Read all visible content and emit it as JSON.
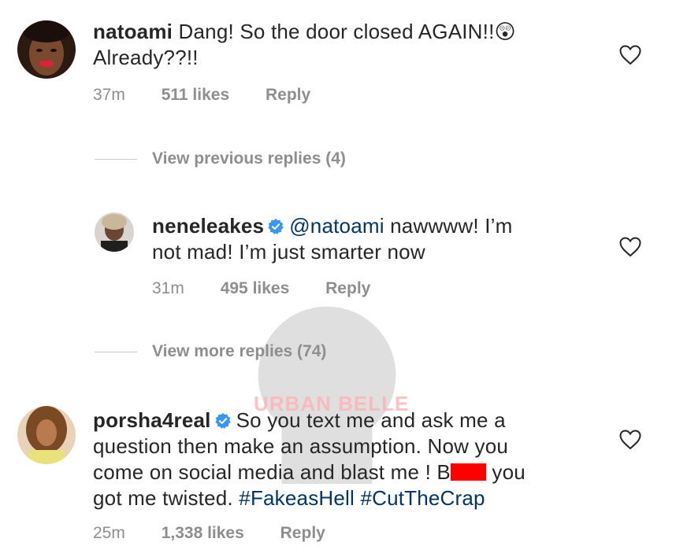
{
  "comments": [
    {
      "username": "natoami",
      "text_line1": "Dang!  So the door closed AGAIN!!",
      "text_line2": "Already??!!",
      "emoji": "😲",
      "time": "37m",
      "likes": "511 likes",
      "reply": "Reply"
    }
  ],
  "view_previous": "View previous replies (4)",
  "reply1": {
    "username": "neneleakes",
    "mention": "@natoami",
    "text_line1": " nawwww! I’m",
    "text_line2": "not mad! I’m just smarter now",
    "time": "31m",
    "likes": "495 likes",
    "reply": "Reply"
  },
  "view_more": "View more replies (74)",
  "comment2": {
    "username": "porsha4real",
    "text_line1": "So you text me and ask me a",
    "text_line2": "question then make an assumption. Now you",
    "text_line3a": "come on social media and blast me ! B",
    "text_line3b": " you",
    "text_line4a": "got me twisted. ",
    "hashtag1": "#FakeasHell",
    "hashtag2": "#CutTheCrap",
    "time": "25m",
    "likes": "1,338 likes",
    "reply": "Reply"
  },
  "watermark": "URBAN BELLE",
  "colors": {
    "text": "#262626",
    "meta": "#8e8e8e",
    "link": "#003569",
    "verified": "#3897f0",
    "redaction": "#ff0000"
  }
}
